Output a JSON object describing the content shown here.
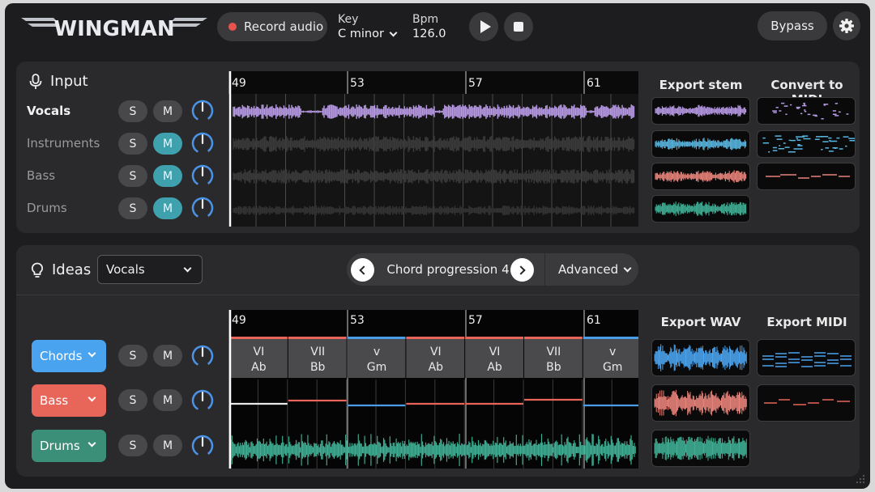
{
  "header": {
    "logo_text": "WINGMAN",
    "record_label": "Record audio",
    "key_label": "Key",
    "key_value": "C minor",
    "bpm_label": "Bpm",
    "bpm_value": "126.0",
    "bypass_label": "Bypass"
  },
  "input": {
    "title": "Input",
    "bars": [
      "49",
      "53",
      "57",
      "61"
    ],
    "export_stem_label": "Export stem",
    "convert_midi_label": "Convert to MIDI",
    "tracks": [
      {
        "name": "Vocals",
        "s": "S",
        "m": "M",
        "muted": false,
        "color": "#b799e3"
      },
      {
        "name": "Instruments",
        "s": "S",
        "m": "M",
        "muted": true,
        "color": "#58b5e0"
      },
      {
        "name": "Bass",
        "s": "S",
        "m": "M",
        "muted": true,
        "color": "#e8837a"
      },
      {
        "name": "Drums",
        "s": "S",
        "m": "M",
        "muted": true,
        "color": "#3fae94"
      }
    ]
  },
  "ideas": {
    "title": "Ideas",
    "source_value": "Vocals",
    "progression_label": "Chord progression 4",
    "advanced_label": "Advanced",
    "bars": [
      "49",
      "53",
      "57",
      "61"
    ],
    "export_wav_label": "Export WAV",
    "export_midi_label": "Export MIDI",
    "chords": [
      {
        "numeral": "VI",
        "name": "Ab",
        "color": "#e8655a"
      },
      {
        "numeral": "VII",
        "name": "Bb",
        "color": "#e8655a"
      },
      {
        "numeral": "v",
        "name": "Gm",
        "color": "#4a9de8"
      },
      {
        "numeral": "VI",
        "name": "Ab",
        "color": "#e8655a"
      },
      {
        "numeral": "VI",
        "name": "Ab",
        "color": "#e8655a"
      },
      {
        "numeral": "VII",
        "name": "Bb",
        "color": "#e8655a"
      },
      {
        "numeral": "v",
        "name": "Gm",
        "color": "#4a9de8"
      }
    ],
    "tracks": [
      {
        "name": "Chords",
        "s": "S",
        "m": "M",
        "color": "#4aa3ef"
      },
      {
        "name": "Bass",
        "s": "S",
        "m": "M",
        "color": "#e8655a"
      },
      {
        "name": "Drums",
        "s": "S",
        "m": "M",
        "color": "#3b8f78"
      }
    ]
  },
  "colors": {
    "vocals": "#b799e3",
    "instruments": "#58b5e0",
    "bass": "#e8837a",
    "drums": "#3fae94",
    "chords_blue": "#4aa3ef",
    "bass_red": "#e8655a",
    "knob_blue": "#4b93e6"
  }
}
